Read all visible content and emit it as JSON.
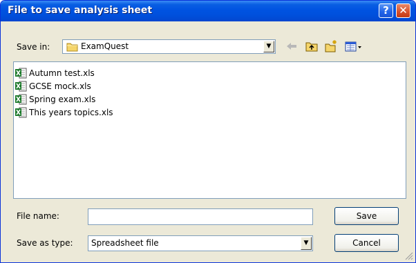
{
  "window": {
    "title": "File to save analysis sheet"
  },
  "titlebar": {
    "help_glyph": "?",
    "close_glyph": "✕"
  },
  "toolbar": {
    "save_in_label": "Save in:",
    "location": "ExamQuest",
    "location_icon": "folder-icon",
    "tools": [
      "back-arrow-icon",
      "up-folder-icon",
      "new-folder-icon",
      "view-menu-icon"
    ]
  },
  "files": [
    {
      "name": "Autumn test.xls",
      "icon": "excel-file-icon"
    },
    {
      "name": "GCSE mock.xls",
      "icon": "excel-file-icon"
    },
    {
      "name": "Spring exam.xls",
      "icon": "excel-file-icon"
    },
    {
      "name": "This years topics.xls",
      "icon": "excel-file-icon"
    }
  ],
  "form": {
    "file_name_label": "File name:",
    "file_name_value": "",
    "type_label": "Save as type:",
    "type_value": "Spreadsheet file"
  },
  "buttons": {
    "save": "Save",
    "cancel": "Cancel"
  },
  "colors": {
    "title_bar": "#0053e1",
    "dialog_bg": "#ece9d8",
    "field_border": "#7f9db9"
  }
}
